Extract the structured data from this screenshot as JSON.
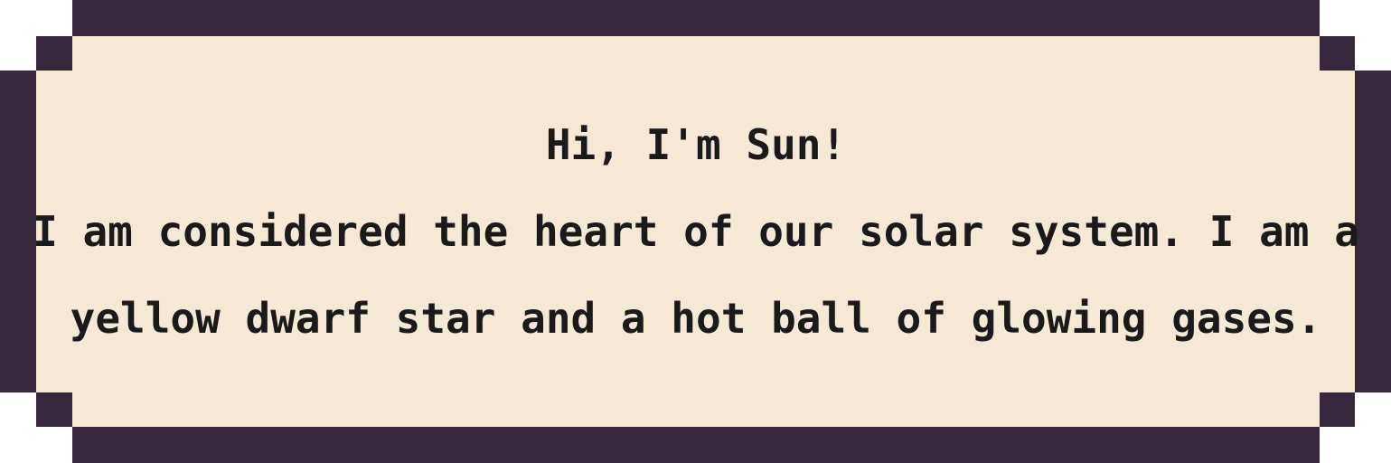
{
  "dialog": {
    "greeting": "Hi, I'm Sun!",
    "lines": [
      "I am considered the heart of our solar system. I am a",
      "yellow dwarf star and a hot ball of glowing gases."
    ]
  },
  "colors": {
    "border": "#37283d",
    "background": "#f5e8d5",
    "text": "#1a1a1a"
  }
}
